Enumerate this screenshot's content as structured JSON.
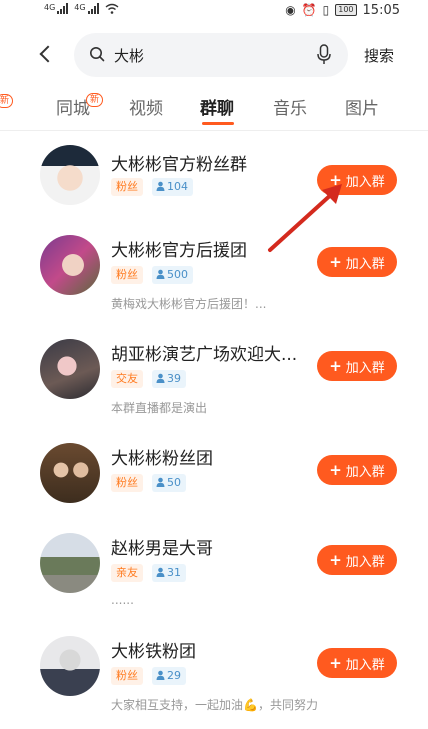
{
  "status_bar": {
    "signal_1_label": "4G",
    "signal_2_label": "4G",
    "battery": "100",
    "time": "15:05",
    "icons": [
      "eye-icon",
      "alarm-icon",
      "vibrate-icon"
    ]
  },
  "search": {
    "query": "大彬",
    "button_label": "搜索"
  },
  "tabs": [
    {
      "label": "同城",
      "badge": "新"
    },
    {
      "label": "视频"
    },
    {
      "label": "群聊",
      "active": true
    },
    {
      "label": "音乐"
    },
    {
      "label": "图片"
    }
  ],
  "left_partial_badge": "新",
  "groups": [
    {
      "name": "大彬彬官方粉丝群",
      "tag": "粉丝",
      "members": "104",
      "desc": "",
      "join_label": "加入群"
    },
    {
      "name": "大彬彬官方后援团",
      "tag": "粉丝",
      "members": "500",
      "desc": "黄梅戏大彬彬官方后援团！...",
      "join_label": "加入群"
    },
    {
      "name": "胡亚彬演艺广场欢迎大...",
      "tag": "交友",
      "members": "39",
      "desc": "本群直播都是演出",
      "join_label": "加入群"
    },
    {
      "name": "大彬彬粉丝团",
      "tag": "粉丝",
      "members": "50",
      "desc": "",
      "join_label": "加入群"
    },
    {
      "name": "赵彬男是大哥",
      "tag": "亲友",
      "members": "31",
      "desc": "......",
      "join_label": "加入群"
    },
    {
      "name": "大彬铁粉团",
      "tag": "粉丝",
      "members": "29",
      "desc": "大家相互支持，一起加油💪，共同努力",
      "join_label": "加入群"
    }
  ],
  "colors": {
    "accent": "#ff5a1f",
    "tag_text": "#ff7a1f",
    "tag_bg": "#fff1e7",
    "count_text": "#4a90c8",
    "count_bg": "#eaf4fb",
    "annotation_arrow": "#d42a1e"
  }
}
